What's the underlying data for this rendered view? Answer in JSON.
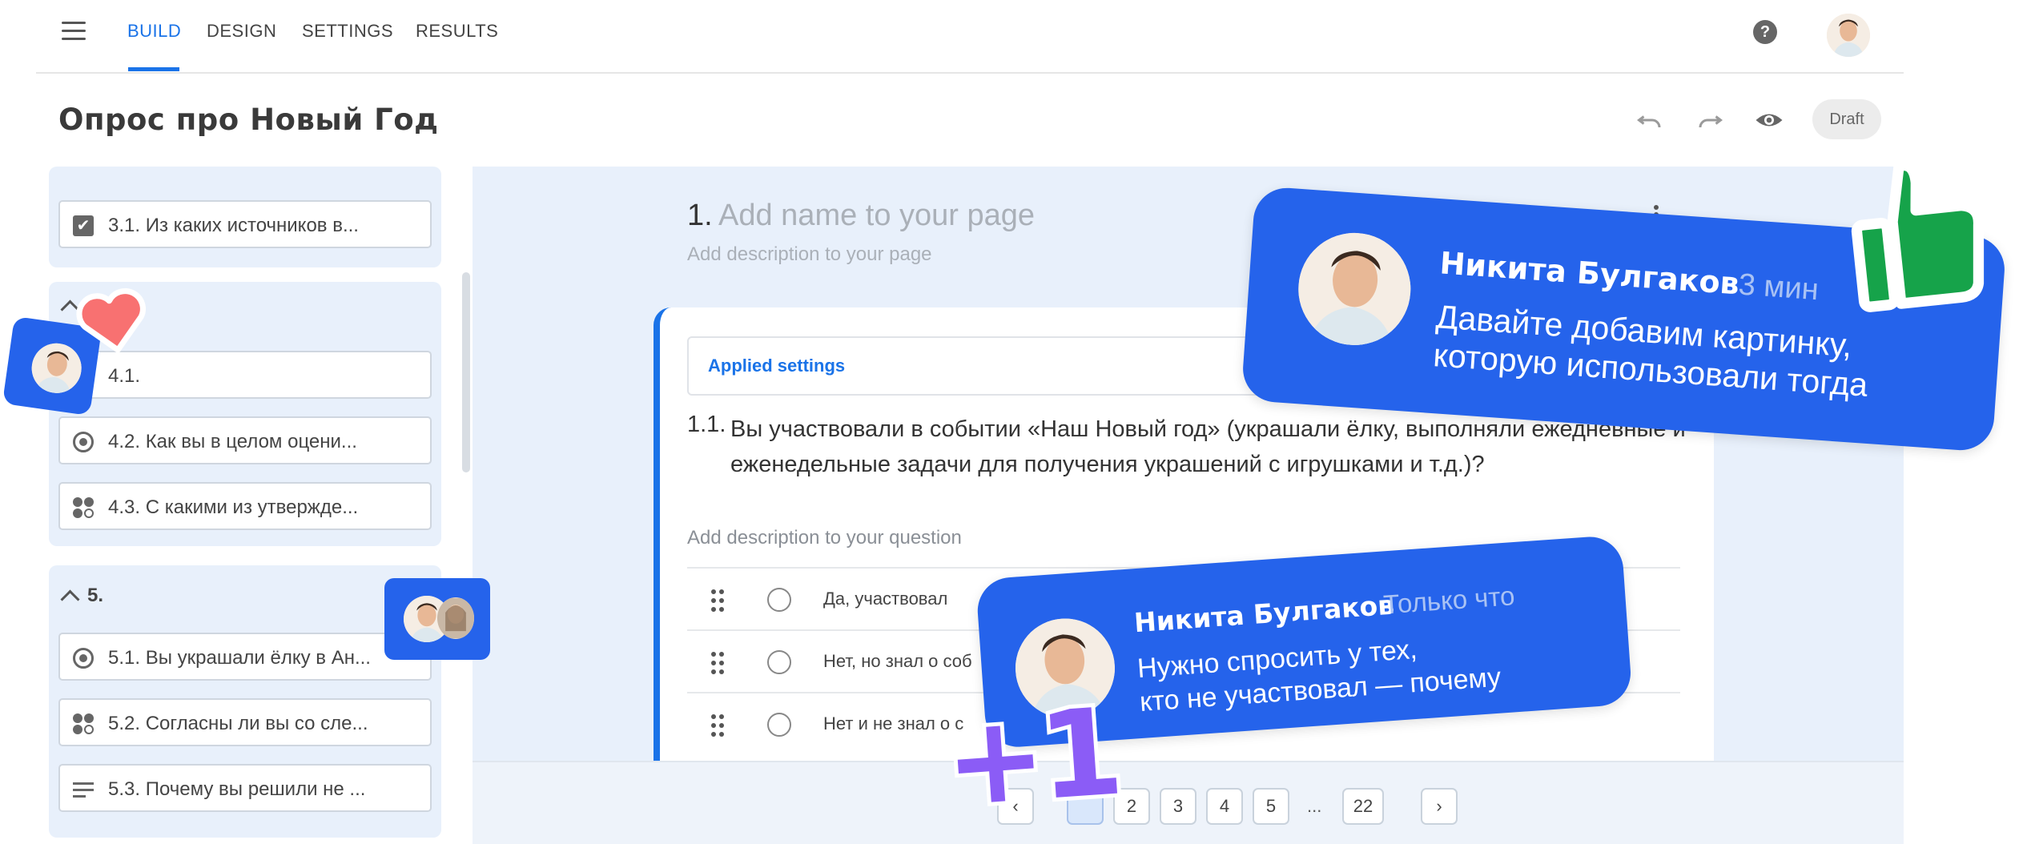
{
  "nav": {
    "tabs": [
      {
        "label": "BUILD",
        "active": true
      },
      {
        "label": "DESIGN",
        "active": false
      },
      {
        "label": "SETTINGS",
        "active": false
      },
      {
        "label": "RESULTS",
        "active": false
      }
    ],
    "icons": [
      "menu-icon",
      "help-icon",
      "avatar"
    ]
  },
  "header": {
    "title": "Опрос про Новый Год",
    "status": "Draft",
    "icons": [
      "undo-icon",
      "redo-icon",
      "preview-eye-icon"
    ]
  },
  "sidebar": {
    "group3": {
      "items": [
        {
          "label": "3.1. Из каких источников в...",
          "icon": "checkbox-icon"
        }
      ]
    },
    "group4": {
      "items": [
        {
          "label": "4.1.",
          "icon": "none"
        },
        {
          "label": "4.2. Как вы в целом оцени...",
          "icon": "radio-icon"
        },
        {
          "label": "4.3. С какими из утвержде...",
          "icon": "matrix-icon"
        }
      ]
    },
    "group5": {
      "title": "5.",
      "items": [
        {
          "label": "5.1. Вы украшали ёлку в Ан...",
          "icon": "radio-icon"
        },
        {
          "label": "5.2. Согласны ли вы со сле...",
          "icon": "matrix-icon"
        },
        {
          "label": "5.3. Почему вы решили не ...",
          "icon": "text-lines-icon"
        }
      ]
    }
  },
  "main": {
    "page_number": "1.",
    "page_name_placeholder": "Add name to your page",
    "page_description_placeholder": "Add description to your page",
    "applied_settings": "Applied settings",
    "question": {
      "number": "1.1.",
      "text": "Вы участвовали в событии «Наш Новый год» (украшали ёлку, выполняли ежедневные и еженедельные задачи для получения украшений с игрушками и т.д.)?",
      "description_placeholder": "Add description to your question",
      "options": [
        "Да, участвовал",
        "Нет, но знал о соб",
        "Нет и не знал о с"
      ]
    }
  },
  "pagination": {
    "pages": [
      "2",
      "3",
      "4",
      "5"
    ],
    "ellipsis": "...",
    "last": "22",
    "next": "›"
  },
  "comments": [
    {
      "author": "Никита Булгаков",
      "time": "3 мин",
      "line1": "Давайте добавим картинку,",
      "line2": "которую использовали тогда"
    },
    {
      "author": "Никита Булгаков",
      "time": "Только что",
      "line1": "Нужно спросить у тех,",
      "line2": "кто не участвовал — почему"
    }
  ],
  "stickers": {
    "plus_one": "+1",
    "icons": [
      "thumbs-up-icon",
      "heart-icon"
    ]
  },
  "colors": {
    "accent": "#1a73e8",
    "bubble": "#2563eb",
    "sidebar_bg": "#e8f0fb",
    "plus_one": "#8b5cf6",
    "thumb": "#16a34a",
    "heart": "#f87171"
  }
}
